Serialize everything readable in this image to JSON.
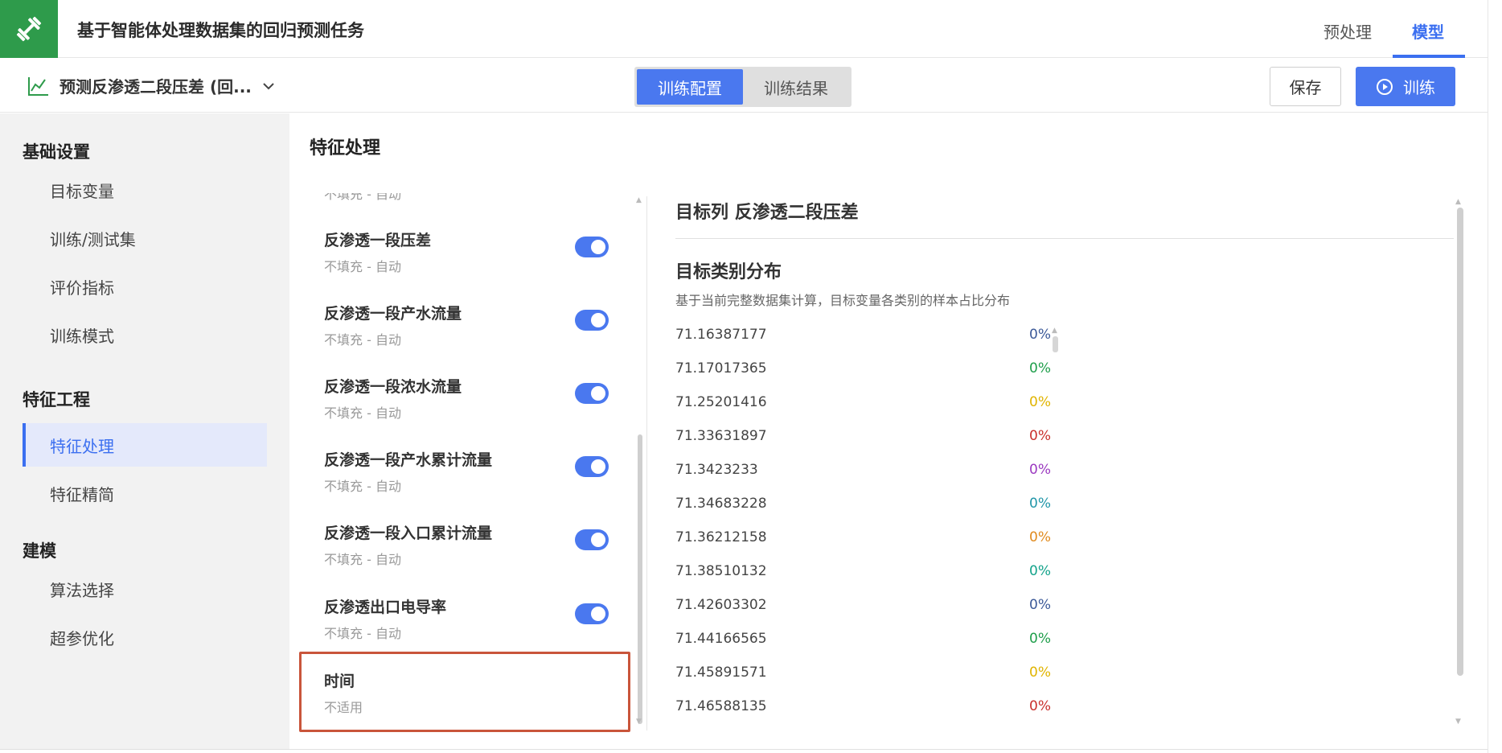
{
  "app": {
    "title": "基于智能体处理数据集的回归预测任务",
    "tabs": [
      {
        "label": "预处理",
        "active": false
      },
      {
        "label": "模型",
        "active": true
      }
    ],
    "logo_icon": "dumbbell-icon",
    "logo_color": "#2e9b4b",
    "accent": "#3b6ff0"
  },
  "subbar": {
    "model_name": "预测反渗透二段压差 (回...",
    "segments": [
      {
        "label": "训练配置",
        "active": true
      },
      {
        "label": "训练结果",
        "active": false
      }
    ],
    "save_label": "保存",
    "train_label": "训练"
  },
  "nav": {
    "groups": [
      {
        "label": "基础设置",
        "items": [
          "目标变量",
          "训练/测试集",
          "评价指标",
          "训练模式"
        ]
      },
      {
        "label": "特征工程",
        "items": [
          "特征处理",
          "特征精简"
        ]
      },
      {
        "label": "建模",
        "items": [
          "算法选择",
          "超参优化"
        ]
      }
    ],
    "active_item": "特征处理"
  },
  "main": {
    "title": "特征处理",
    "cut_text": "不填充 - 自动",
    "features": [
      {
        "name": "反渗透一段压差",
        "sub": "不填充 - 自动",
        "enabled": true
      },
      {
        "name": "反渗透一段产水流量",
        "sub": "不填充 - 自动",
        "enabled": true
      },
      {
        "name": "反渗透一段浓水流量",
        "sub": "不填充 - 自动",
        "enabled": true
      },
      {
        "name": "反渗透一段产水累计流量",
        "sub": "不填充 - 自动",
        "enabled": true
      },
      {
        "name": "反渗透一段入口累计流量",
        "sub": "不填充 - 自动",
        "enabled": true
      },
      {
        "name": "反渗透出口电导率",
        "sub": "不填充 - 自动",
        "enabled": true
      },
      {
        "name": "时间",
        "sub": "不适用",
        "enabled": false
      }
    ]
  },
  "detail": {
    "title": "目标列 反渗透二段压差",
    "dist_title": "目标类别分布",
    "dist_desc": "基于当前完整数据集计算，目标变量各类别的样本占比分布",
    "rows": [
      {
        "value": "71.16387177",
        "pct": "0%",
        "color": "#3b5998"
      },
      {
        "value": "71.17017365",
        "pct": "0%",
        "color": "#1e9e4a"
      },
      {
        "value": "71.25201416",
        "pct": "0%",
        "color": "#e0b400"
      },
      {
        "value": "71.33631897",
        "pct": "0%",
        "color": "#c9302c"
      },
      {
        "value": "71.3423233",
        "pct": "0%",
        "color": "#9b39c0"
      },
      {
        "value": "71.34683228",
        "pct": "0%",
        "color": "#2196a8"
      },
      {
        "value": "71.36212158",
        "pct": "0%",
        "color": "#e08a1e"
      },
      {
        "value": "71.38510132",
        "pct": "0%",
        "color": "#14a38b"
      },
      {
        "value": "71.42603302",
        "pct": "0%",
        "color": "#3b5998"
      },
      {
        "value": "71.44166565",
        "pct": "0%",
        "color": "#1e9e4a"
      },
      {
        "value": "71.45891571",
        "pct": "0%",
        "color": "#e0b400"
      },
      {
        "value": "71.46588135",
        "pct": "0%",
        "color": "#c9302c"
      }
    ]
  }
}
